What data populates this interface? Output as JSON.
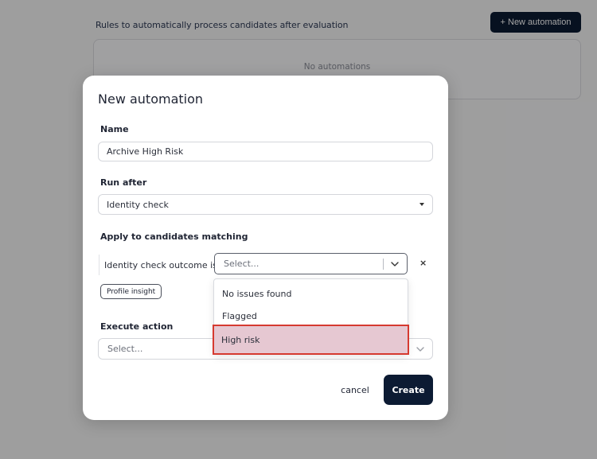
{
  "background": {
    "description": "Rules to automatically process candidates after evaluation",
    "new_button": "+ New automation",
    "empty_text": "No automations"
  },
  "modal": {
    "title": "New automation",
    "name_label": "Name",
    "name_value": "Archive High Risk",
    "run_after_label": "Run after",
    "run_after_value": "Identity check",
    "apply_label": "Apply to candidates matching",
    "condition_label": "Identity check outcome is",
    "condition_placeholder": "Select...",
    "clear_symbol": "×",
    "chip_label": "Profile insight",
    "execute_label": "Execute action",
    "execute_placeholder": "Select...",
    "cancel_label": "cancel",
    "create_label": "Create"
  },
  "dropdown": {
    "options": [
      "No issues found",
      "Flagged",
      "High risk"
    ],
    "highlighted": "High risk"
  },
  "colors": {
    "primary": "#0c1b33",
    "highlight_bg": "#e6c8d2",
    "highlight_border": "#d63a30"
  }
}
